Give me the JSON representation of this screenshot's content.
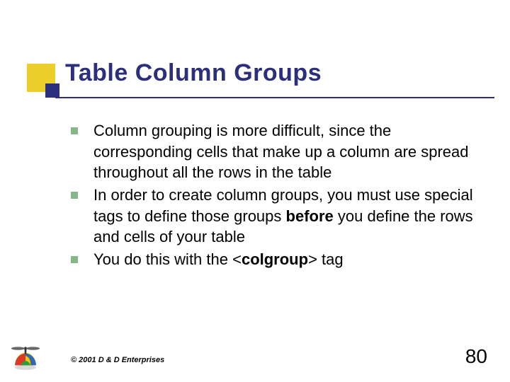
{
  "title": "Table Column Groups",
  "bullets": [
    {
      "pre": "Column grouping is more difficult, since the corresponding cells that make up a column are spread throughout all the rows in the table",
      "bold": "",
      "post": ""
    },
    {
      "pre": "In order to create column groups, you must use special tags to define those groups ",
      "bold": "before",
      "post": " you define the rows and cells of your table"
    },
    {
      "pre": "You do this with the <",
      "bold": "colgroup",
      "post": "> tag"
    }
  ],
  "footer": {
    "copyright": "© 2001 D & D Enterprises",
    "page": "80"
  },
  "colors": {
    "navy": "#2b2f7c",
    "yellow": "#edcf2b",
    "bullet": "#85b788"
  }
}
